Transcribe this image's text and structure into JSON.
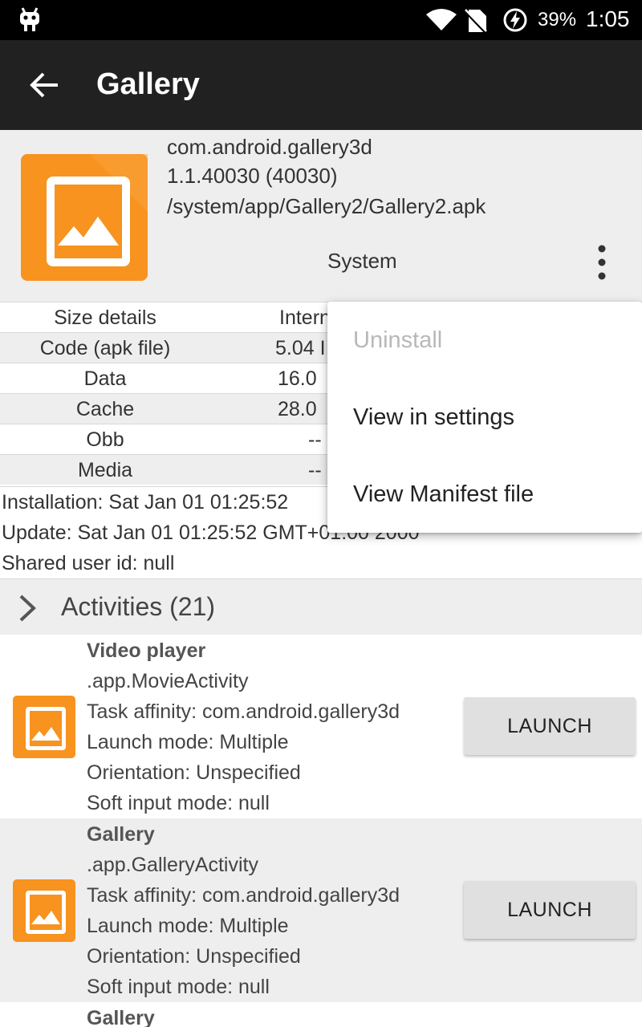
{
  "status_bar": {
    "battery_percent": "39%",
    "time": "1:05"
  },
  "app_bar": {
    "title": "Gallery"
  },
  "app_info": {
    "package": "com.android.gallery3d",
    "version": "1.1.40030 (40030)",
    "path": "/system/app/Gallery2/Gallery2.apk",
    "type": "System"
  },
  "size_table": {
    "header": {
      "label": "Size details",
      "internal": "Intern"
    },
    "rows": [
      {
        "label": "Code (apk file)",
        "value": "5.04 I"
      },
      {
        "label": "Data",
        "value": "16.0"
      },
      {
        "label": "Cache",
        "value": "28.0"
      },
      {
        "label": "Obb",
        "value": "--"
      },
      {
        "label": "Media",
        "value": "--"
      }
    ]
  },
  "info_lines": {
    "installation": "Installation: Sat Jan 01 01:25:52",
    "update": "Update: Sat Jan 01 01:25:52 GMT+01:00 2000",
    "shared_user": "Shared user id: null"
  },
  "activities": {
    "header": "Activities (21)",
    "items": [
      {
        "name": "Video player",
        "class": ".app.MovieActivity",
        "affinity": "Task affinity: com.android.gallery3d",
        "launch_mode": "Launch mode: Multiple",
        "orientation": "Orientation: Unspecified",
        "soft_input": "Soft input mode: null",
        "button": "LAUNCH"
      },
      {
        "name": "Gallery",
        "class": ".app.GalleryActivity",
        "affinity": "Task affinity: com.android.gallery3d",
        "launch_mode": "Launch mode: Multiple",
        "orientation": "Orientation: Unspecified",
        "soft_input": "Soft input mode: null",
        "button": "LAUNCH"
      },
      {
        "name": "Gallery"
      }
    ]
  },
  "popup_menu": {
    "items": [
      {
        "label": "Uninstall",
        "enabled": false
      },
      {
        "label": "View in settings",
        "enabled": true
      },
      {
        "label": "View Manifest file",
        "enabled": true
      }
    ]
  },
  "colors": {
    "app_bar": "#212121",
    "status_bar": "#000000",
    "icon_orange": "#f7931e"
  }
}
